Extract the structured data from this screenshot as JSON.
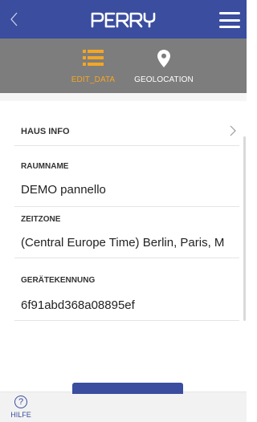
{
  "header": {
    "logo_text": "PERRY",
    "colors": {
      "primary": "#3a4d9f",
      "accent": "#f5a623",
      "tabbar": "#7d7d7d"
    },
    "icons": {
      "back": "chevron-left-icon",
      "menu": "hamburger-menu-icon"
    }
  },
  "tabs": [
    {
      "label": "EDIT_DATA",
      "icon": "list-icon",
      "active": true
    },
    {
      "label": "GEOLOCATION",
      "icon": "map-pin-icon",
      "active": false
    }
  ],
  "section": {
    "label": "HAUS INFO",
    "icon": "chevron-right-icon"
  },
  "fields": {
    "room_name": {
      "label": "RAUMNAME",
      "value": "DEMO pannello"
    },
    "timezone": {
      "label": "ZEITZONE",
      "value": "(Central Europe Time) Berlin, Paris, M"
    },
    "device_id": {
      "label": "GERÄTEKENNUNG",
      "value": "6f91abd368a08895ef"
    }
  },
  "footer": {
    "help_label": "HILFE",
    "help_icon": "question-circle-icon"
  }
}
